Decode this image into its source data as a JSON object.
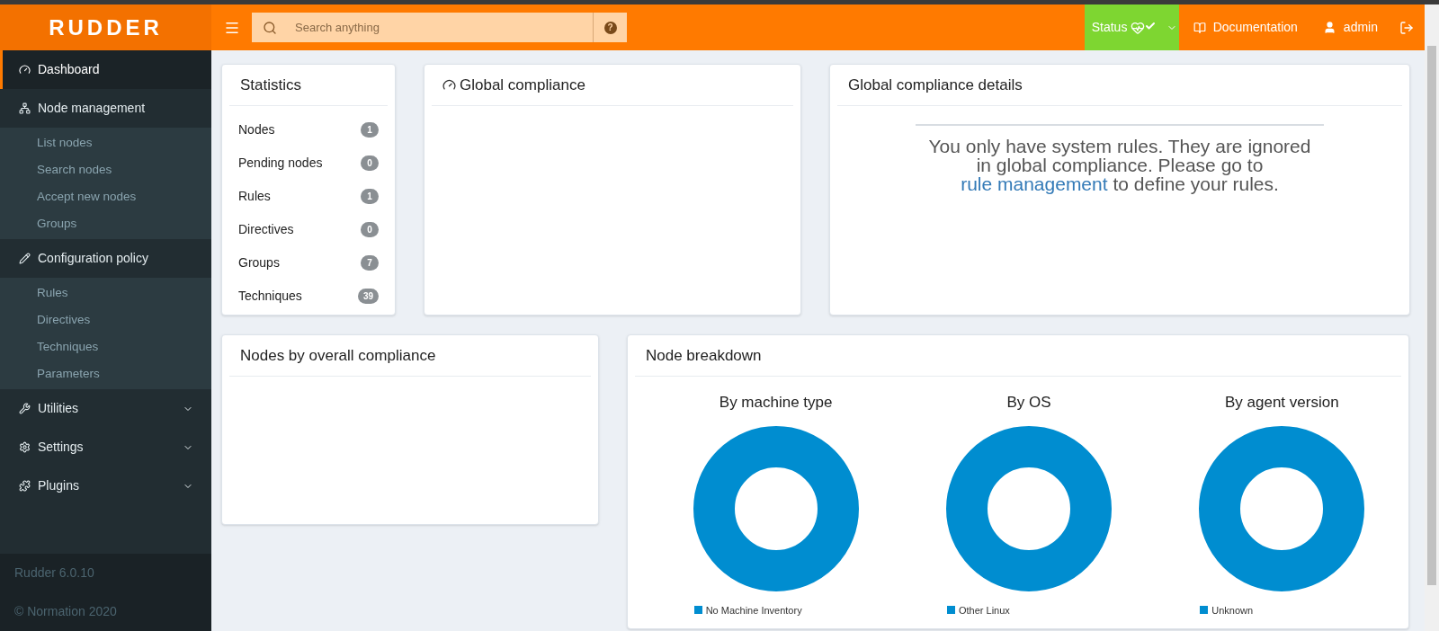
{
  "header": {
    "logo": "RUDDER",
    "search": {
      "placeholder": "Search anything",
      "help": "?"
    },
    "status": {
      "label": "Status"
    },
    "links": [
      {
        "label": "Documentation"
      },
      {
        "label": "admin"
      }
    ]
  },
  "sidebar": {
    "items": [
      {
        "label": "Dashboard",
        "selected": true
      },
      {
        "label": "Node management",
        "selected": false,
        "expanded": true,
        "children": [
          {
            "label": "List nodes",
            "selected": false
          },
          {
            "label": "Search nodes",
            "selected": false
          },
          {
            "label": "Accept new nodes",
            "selected": false
          },
          {
            "label": "Groups",
            "selected": false
          }
        ]
      },
      {
        "label": "Configuration policy",
        "selected": false,
        "expanded": true,
        "children": [
          {
            "label": "Rules",
            "selected": false
          },
          {
            "label": "Directives",
            "selected": false
          },
          {
            "label": "Techniques",
            "selected": false
          },
          {
            "label": "Parameters",
            "selected": false
          }
        ]
      },
      {
        "label": "Utilities",
        "selected": false,
        "expanded": false
      },
      {
        "label": "Settings",
        "selected": false,
        "expanded": false
      },
      {
        "label": "Plugins",
        "selected": false,
        "expanded": false
      }
    ],
    "version": "Rudder 6.0.10",
    "copyright": "© Normation 2020"
  },
  "statistics": {
    "title": "Statistics",
    "rows": [
      {
        "label": "Nodes",
        "count": "1"
      },
      {
        "label": "Pending nodes",
        "count": "0"
      },
      {
        "label": "Rules",
        "count": "1"
      },
      {
        "label": "Directives",
        "count": "0"
      },
      {
        "label": "Groups",
        "count": "7"
      },
      {
        "label": "Techniques",
        "count": "39"
      }
    ]
  },
  "global_compliance": {
    "title": "Global compliance"
  },
  "global_compliance_details": {
    "title": "Global compliance details",
    "message_before": "You only have system rules. They are ignored in global compliance. Please go to",
    "link": "rule management",
    "message_after": "to define your rules."
  },
  "nodes_by_compliance": {
    "title": "Nodes by overall compliance"
  },
  "node_breakdown": {
    "title": "Node breakdown",
    "charts": [
      {
        "title": "By machine type",
        "legend": "No Machine Inventory",
        "color": "#008dd0"
      },
      {
        "title": "By OS",
        "legend": "Other Linux",
        "color": "#008dd0"
      },
      {
        "title": "By agent version",
        "legend": "Unknown",
        "color": "#008dd0"
      }
    ]
  }
}
